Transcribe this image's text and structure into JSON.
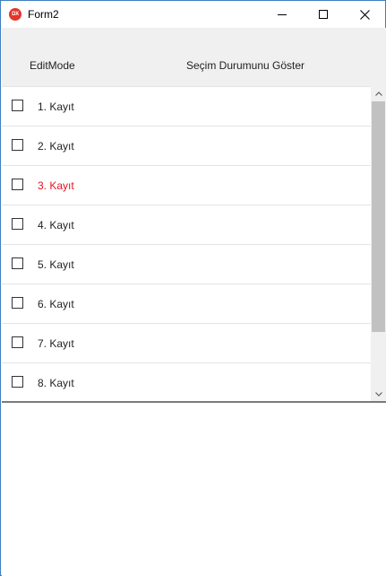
{
  "window": {
    "title": "Form2",
    "icon": "devexpress-dx-icon",
    "icon_text": "DX",
    "controls": [
      "minimize-icon",
      "maximize-icon",
      "close-icon"
    ]
  },
  "grid": {
    "columns": [
      "EditMode",
      "Seçim Durumunu Göster"
    ],
    "rows": [
      {
        "label": "1. Kayıt",
        "checked": false
      },
      {
        "label": "2. Kayıt",
        "checked": false
      },
      {
        "label": "3. Kayıt",
        "checked": false,
        "highlight_color": "#e81123"
      },
      {
        "label": "4. Kayıt",
        "checked": false
      },
      {
        "label": "5. Kayıt",
        "checked": false
      },
      {
        "label": "6. Kayıt",
        "checked": false
      },
      {
        "label": "7. Kayıt",
        "checked": false
      },
      {
        "label": "8. Kayıt",
        "checked": false
      }
    ]
  },
  "colors": {
    "window_border": "#3c7fc1",
    "header_background": "#f0f0f0",
    "highlight_text": "#e81123"
  }
}
